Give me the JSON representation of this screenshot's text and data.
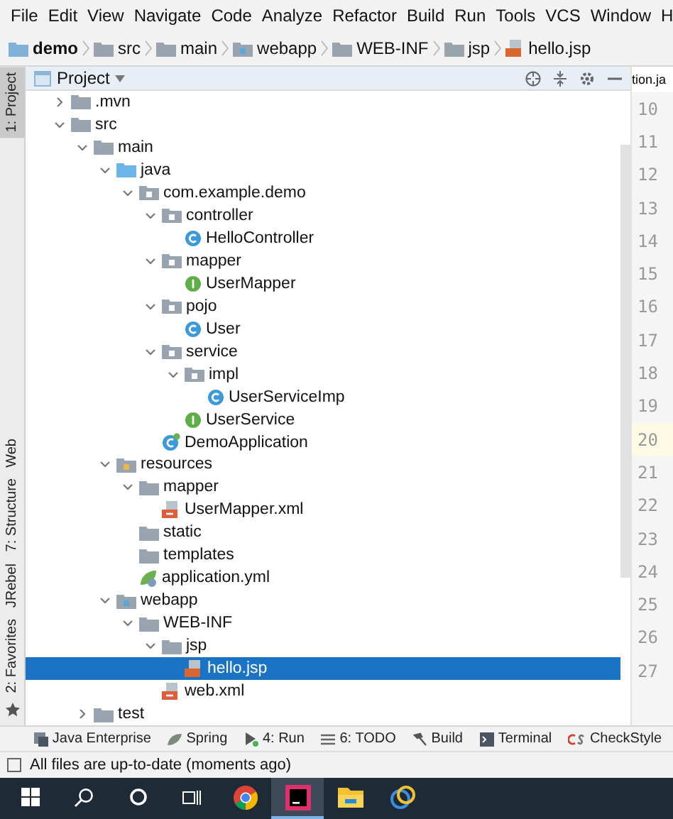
{
  "menu_bar": {
    "items": [
      "File",
      "Edit",
      "View",
      "Navigate",
      "Code",
      "Analyze",
      "Refactor",
      "Build",
      "Run",
      "Tools",
      "VCS",
      "Window",
      "H"
    ]
  },
  "breadcrumb": [
    {
      "label": "demo",
      "kind": "module"
    },
    {
      "label": "src",
      "kind": "folder"
    },
    {
      "label": "main",
      "kind": "folder"
    },
    {
      "label": "webapp",
      "kind": "web"
    },
    {
      "label": "WEB-INF",
      "kind": "folder"
    },
    {
      "label": "jsp",
      "kind": "folder"
    },
    {
      "label": "hello.jsp",
      "kind": "jsp"
    }
  ],
  "left_strip": [
    {
      "label": "1: Project",
      "selected": true
    },
    {
      "label": "Web",
      "selected": false
    },
    {
      "label": "7: Structure",
      "selected": false
    },
    {
      "label": "JRebel",
      "selected": false
    },
    {
      "label": "2: Favorites",
      "selected": false
    }
  ],
  "project_panel": {
    "title": "Project",
    "tree": [
      {
        "label": ".mvn",
        "kind": "folder",
        "expanded": false,
        "selected": false
      },
      {
        "label": "src",
        "kind": "folder",
        "expanded": true,
        "selected": false,
        "children": [
          {
            "label": "main",
            "kind": "folder",
            "expanded": true,
            "selected": false,
            "children": [
              {
                "label": "java",
                "kind": "source",
                "expanded": true,
                "selected": false,
                "children": [
                  {
                    "label": "com.example.demo",
                    "kind": "package",
                    "expanded": true,
                    "selected": false,
                    "children": [
                      {
                        "label": "controller",
                        "kind": "package",
                        "expanded": true,
                        "selected": false,
                        "children": [
                          {
                            "label": "HelloController",
                            "kind": "class",
                            "selected": false
                          }
                        ]
                      },
                      {
                        "label": "mapper",
                        "kind": "package",
                        "expanded": true,
                        "selected": false,
                        "children": [
                          {
                            "label": "UserMapper",
                            "kind": "interface",
                            "selected": false
                          }
                        ]
                      },
                      {
                        "label": "pojo",
                        "kind": "package",
                        "expanded": true,
                        "selected": false,
                        "children": [
                          {
                            "label": "User",
                            "kind": "class",
                            "selected": false
                          }
                        ]
                      },
                      {
                        "label": "service",
                        "kind": "package",
                        "expanded": true,
                        "selected": false,
                        "children": [
                          {
                            "label": "impl",
                            "kind": "package",
                            "expanded": true,
                            "selected": false,
                            "children": [
                              {
                                "label": "UserServiceImp",
                                "kind": "class",
                                "selected": false
                              }
                            ]
                          },
                          {
                            "label": "UserService",
                            "kind": "interface",
                            "selected": false
                          }
                        ]
                      },
                      {
                        "label": "DemoApplication",
                        "kind": "spring",
                        "selected": false
                      }
                    ]
                  }
                ]
              },
              {
                "label": "resources",
                "kind": "resources",
                "expanded": true,
                "selected": false,
                "children": [
                  {
                    "label": "mapper",
                    "kind": "folder",
                    "expanded": true,
                    "selected": false,
                    "children": [
                      {
                        "label": "UserMapper.xml",
                        "kind": "xml",
                        "selected": false
                      }
                    ]
                  },
                  {
                    "label": "static",
                    "kind": "folder",
                    "selected": false
                  },
                  {
                    "label": "templates",
                    "kind": "folder",
                    "selected": false
                  },
                  {
                    "label": "application.yml",
                    "kind": "yml",
                    "selected": false
                  }
                ]
              },
              {
                "label": "webapp",
                "kind": "web",
                "expanded": true,
                "selected": false,
                "children": [
                  {
                    "label": "WEB-INF",
                    "kind": "folder",
                    "expanded": true,
                    "selected": false,
                    "children": [
                      {
                        "label": "jsp",
                        "kind": "folder",
                        "expanded": true,
                        "selected": false,
                        "children": [
                          {
                            "label": "hello.jsp",
                            "kind": "jsp",
                            "selected": true
                          }
                        ]
                      },
                      {
                        "label": "web.xml",
                        "kind": "xml",
                        "selected": false
                      }
                    ]
                  }
                ]
              }
            ]
          },
          {
            "label": "test",
            "kind": "folder",
            "expanded": false,
            "selected": false
          }
        ]
      }
    ]
  },
  "editor": {
    "tab": "tion.ja",
    "line_numbers": [
      {
        "n": "10",
        "current": false
      },
      {
        "n": "11",
        "current": false
      },
      {
        "n": "12",
        "current": false
      },
      {
        "n": "13",
        "current": false
      },
      {
        "n": "14",
        "current": false
      },
      {
        "n": "15",
        "current": false
      },
      {
        "n": "16",
        "current": false
      },
      {
        "n": "17",
        "current": false
      },
      {
        "n": "18",
        "current": false
      },
      {
        "n": "19",
        "current": false
      },
      {
        "n": "20",
        "current": true
      },
      {
        "n": "21",
        "current": false
      },
      {
        "n": "22",
        "current": false
      },
      {
        "n": "23",
        "current": false
      },
      {
        "n": "24",
        "current": false
      },
      {
        "n": "25",
        "current": false
      },
      {
        "n": "26",
        "current": false
      },
      {
        "n": "27",
        "current": false
      }
    ]
  },
  "tool_bar": [
    {
      "label": "Java Enterprise",
      "kind": "enterprise"
    },
    {
      "label": "Spring",
      "kind": "spring"
    },
    {
      "label": "4: Run",
      "kind": "run"
    },
    {
      "label": "6: TODO",
      "kind": "todo"
    },
    {
      "label": "Build",
      "kind": "build"
    },
    {
      "label": "Terminal",
      "kind": "terminal"
    },
    {
      "label": "CheckStyle",
      "kind": "checkstyle"
    }
  ],
  "status_bar": {
    "message": "All files are up-to-date (moments ago)"
  },
  "taskbar": [
    {
      "kind": "start",
      "selected": false
    },
    {
      "kind": "search",
      "selected": false
    },
    {
      "kind": "cortana",
      "selected": false
    },
    {
      "kind": "taskview",
      "selected": false
    },
    {
      "kind": "browser",
      "selected": false
    },
    {
      "kind": "ide",
      "selected": true
    },
    {
      "kind": "explorer",
      "selected": false
    },
    {
      "kind": "app",
      "selected": false
    }
  ]
}
